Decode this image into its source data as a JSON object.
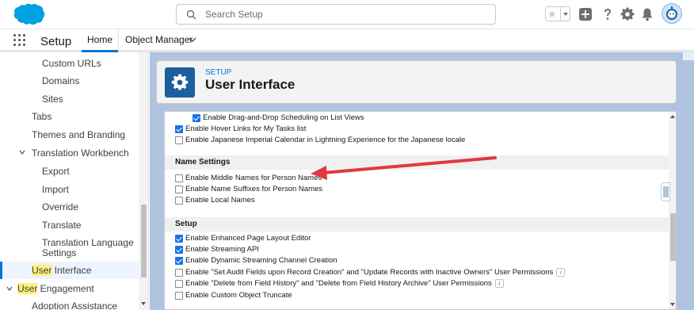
{
  "header": {
    "search_placeholder": "Search Setup"
  },
  "context": {
    "app_name": "Setup",
    "tabs": [
      {
        "label": "Home"
      },
      {
        "label": "Object Manager"
      }
    ]
  },
  "sidebar": {
    "items": [
      {
        "label": "Custom URLs"
      },
      {
        "label": "Domains"
      },
      {
        "label": "Sites"
      },
      {
        "label": "Tabs"
      },
      {
        "label": "Themes and Branding"
      },
      {
        "label": "Translation Workbench"
      },
      {
        "label": "Export"
      },
      {
        "label": "Import"
      },
      {
        "label": "Override"
      },
      {
        "label": "Translate"
      },
      {
        "label": "Translation Language Settings"
      },
      {
        "label_hl": "User",
        "label_rest": " Interface"
      },
      {
        "label_hl": "User",
        "label_rest": " Engagement"
      },
      {
        "label": "Adoption Assistance"
      }
    ]
  },
  "page": {
    "eyebrow": "SETUP",
    "title": "User Interface"
  },
  "content": {
    "top_rows": [
      {
        "label": "Enable Drag-and-Drop Scheduling on List Views",
        "checked": true
      },
      {
        "label": "Enable Hover Links for My Tasks list",
        "checked": true
      },
      {
        "label": "Enable Japanese Imperial Calendar in Lightning Experience for the Japanese locale",
        "checked": false
      }
    ],
    "name_settings": {
      "heading": "Name Settings",
      "rows": [
        {
          "label": "Enable Middle Names for Person Names",
          "checked": false
        },
        {
          "label": "Enable Name Suffixes for Person Names",
          "checked": false
        },
        {
          "label": "Enable Local Names",
          "checked": false
        }
      ]
    },
    "setup": {
      "heading": "Setup",
      "rows": [
        {
          "label": "Enable Enhanced Page Layout Editor",
          "checked": true
        },
        {
          "label": "Enable Streaming API",
          "checked": true
        },
        {
          "label": "Enable Dynamic Streaming Channel Creation",
          "checked": true
        },
        {
          "label": "Enable \"Set Audit Fields upon Record Creation\" and \"Update Records with Inactive Owners\" User Permissions",
          "checked": false
        },
        {
          "label": "Enable \"Delete from Field History\" and \"Delete from Field History Archive\" User Permissions",
          "checked": false
        },
        {
          "label": "Enable Custom Object Truncate",
          "checked": false
        }
      ]
    }
  },
  "colors": {
    "brand": "#0176d3",
    "annotation_arrow": "#e0383e",
    "setup_tile": "#1b5f9e",
    "main_bg": "#b0c4df"
  },
  "icons": [
    "salesforce-logo",
    "search-icon",
    "favorite-star-icon",
    "add-icon",
    "help-icon",
    "gear-icon",
    "notification-bell-icon",
    "avatar",
    "app-launcher-icon",
    "chevron-down-icon",
    "setup-gear-icon",
    "info-icon"
  ]
}
